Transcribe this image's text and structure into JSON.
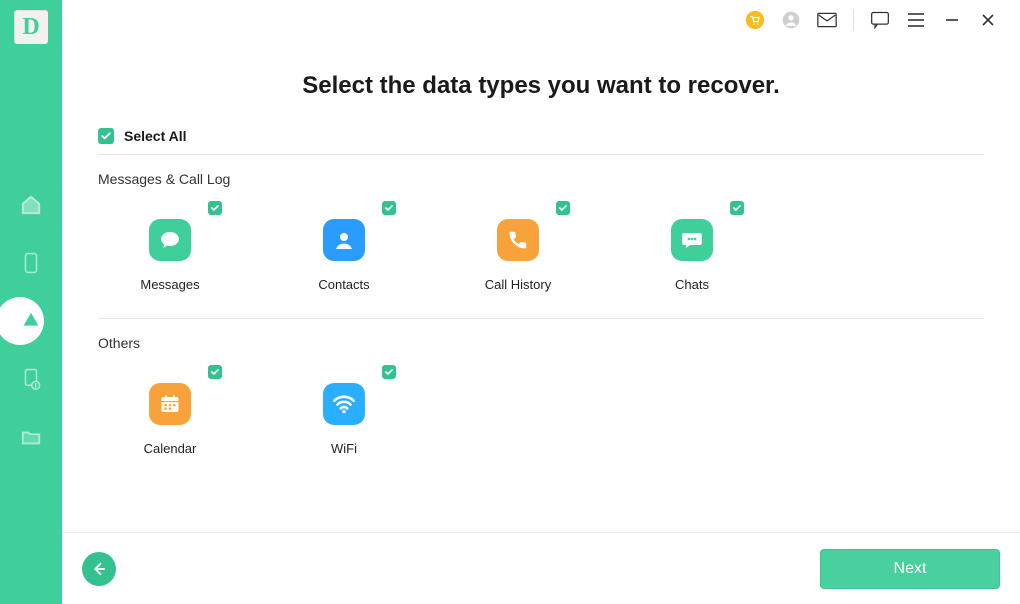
{
  "colors": {
    "accent": "#3ecf9a",
    "orange": "#f7a23b",
    "blue": "#2a9bff",
    "cyan": "#2aaeff"
  },
  "sidebar": {
    "logo_letter": "D"
  },
  "header": {
    "icons": [
      "cart",
      "user",
      "mail",
      "chat",
      "menu",
      "minimize",
      "close"
    ]
  },
  "page": {
    "title": "Select the data types you want to recover.",
    "select_all_label": "Select All",
    "select_all_checked": true,
    "next_label": "Next"
  },
  "sections": [
    {
      "title": "Messages & Call Log",
      "items": [
        {
          "icon": "messages",
          "color": "green",
          "label": "Messages",
          "checked": true
        },
        {
          "icon": "contacts",
          "color": "blue",
          "label": "Contacts",
          "checked": true
        },
        {
          "icon": "phone",
          "color": "orange",
          "label": "Call History",
          "checked": true
        },
        {
          "icon": "chats",
          "color": "teal",
          "label": "Chats",
          "checked": true
        }
      ]
    },
    {
      "title": "Others",
      "items": [
        {
          "icon": "calendar",
          "color": "orange",
          "label": "Calendar",
          "checked": true
        },
        {
          "icon": "wifi",
          "color": "cyan",
          "label": "WiFi",
          "checked": true
        }
      ]
    }
  ]
}
